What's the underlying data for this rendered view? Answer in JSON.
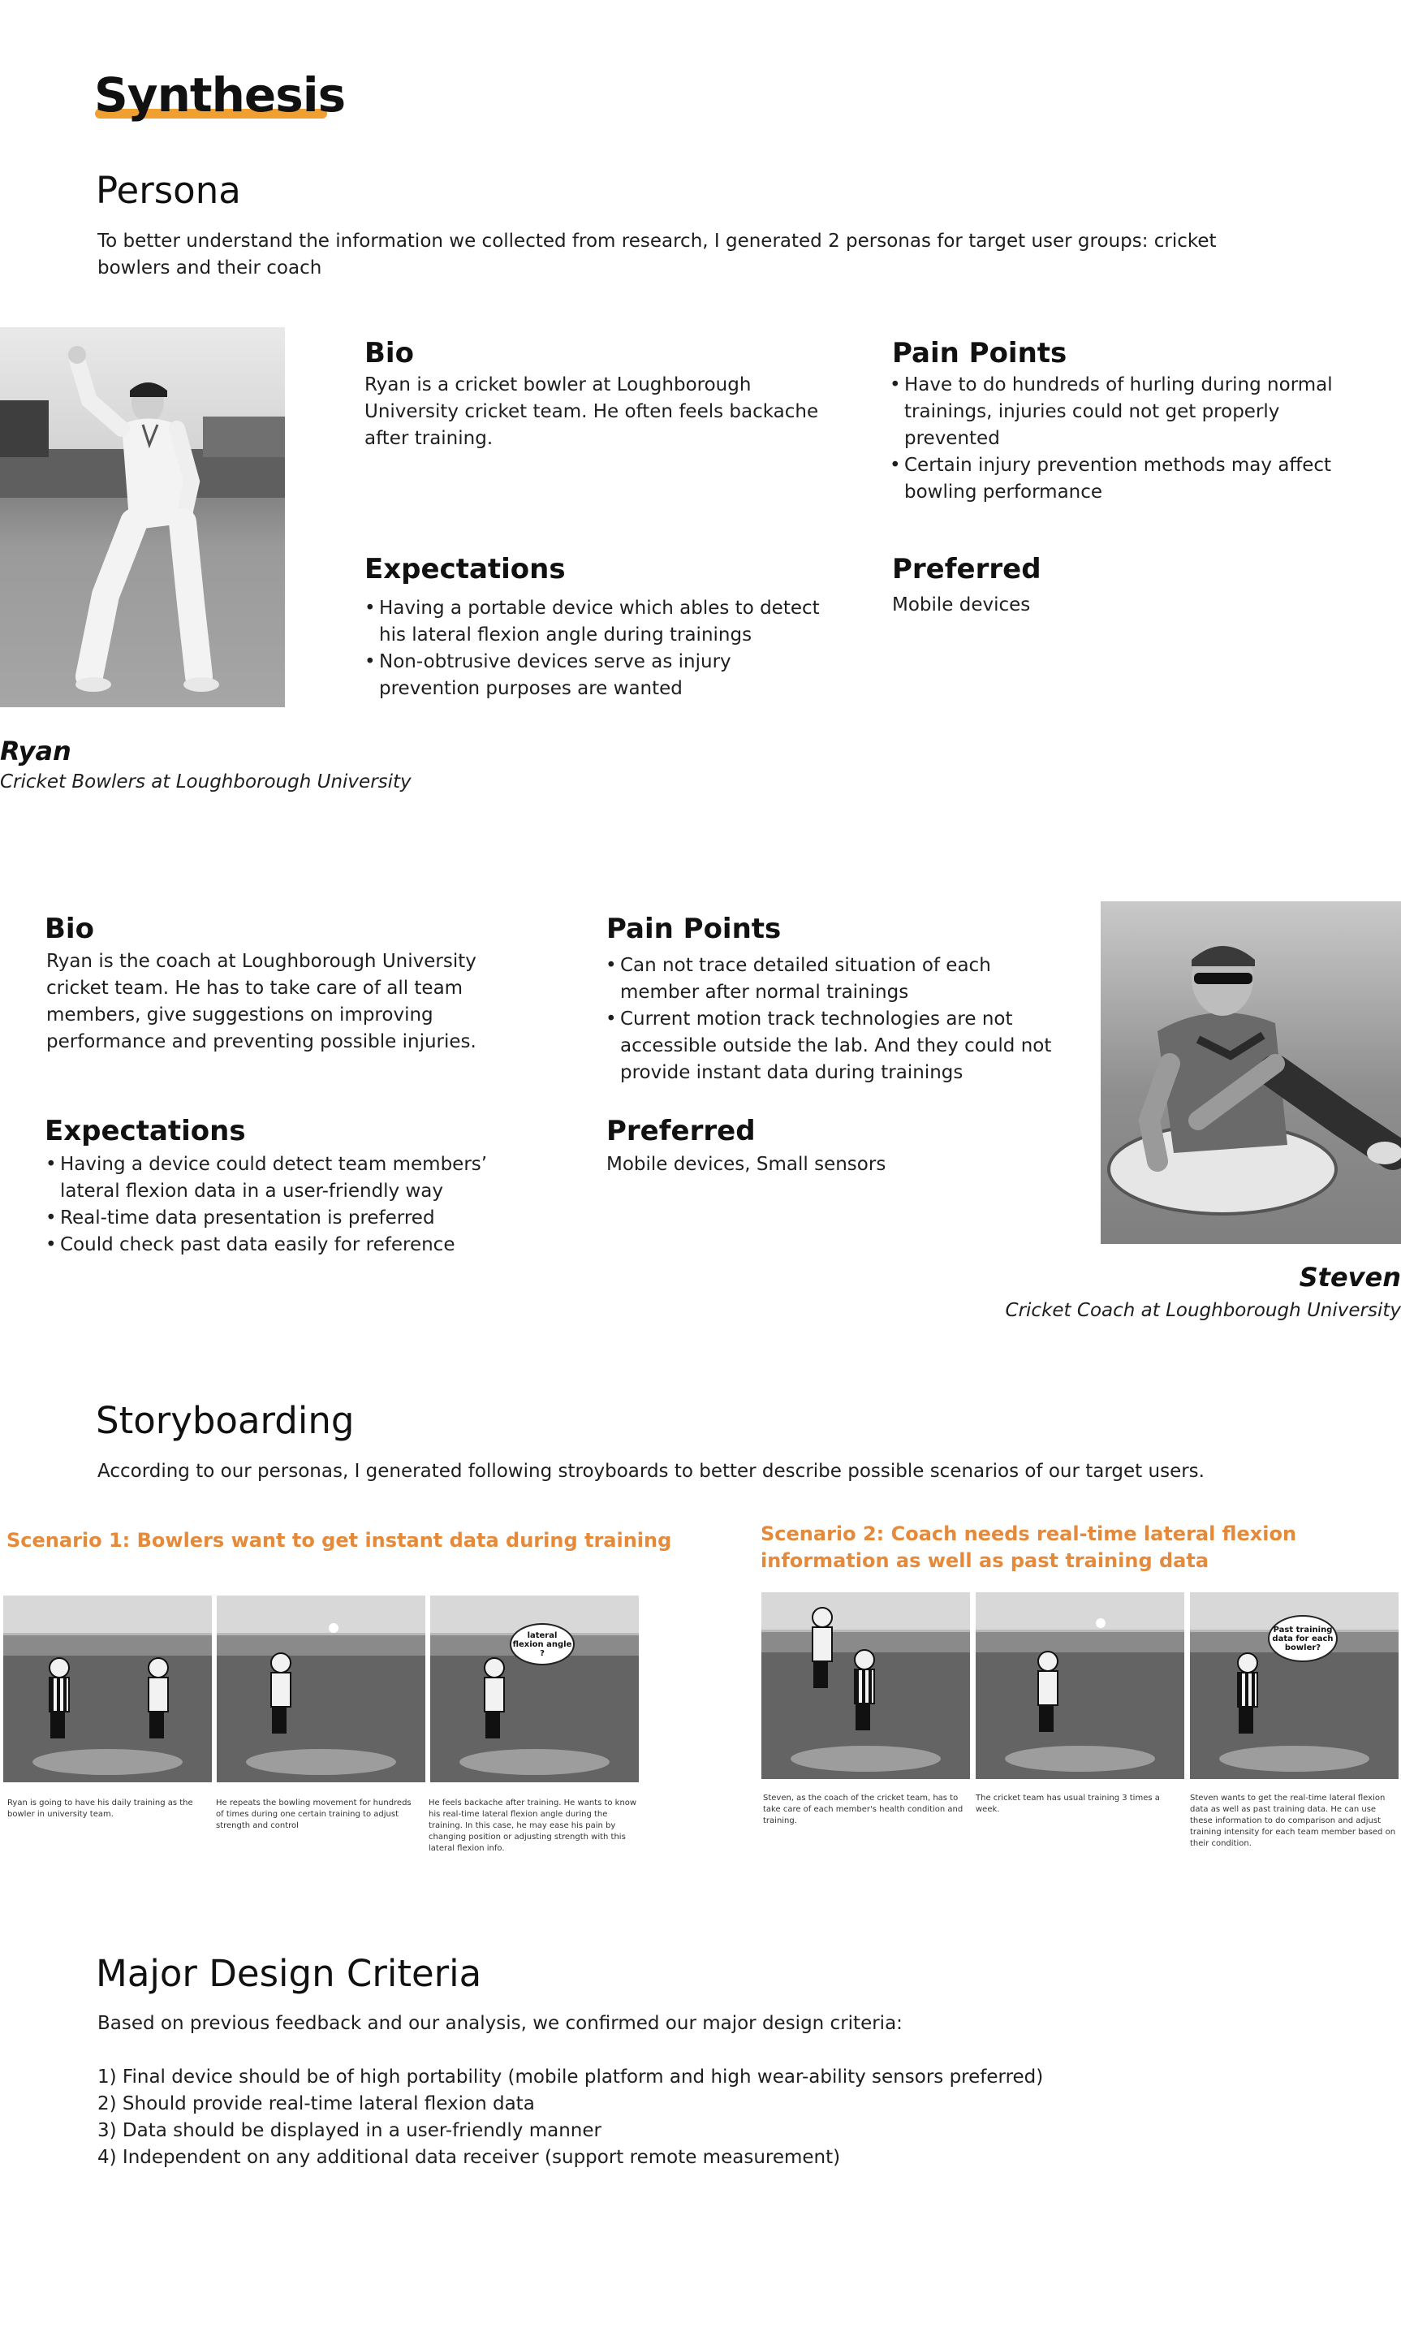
{
  "header": {
    "title": "Synthesis"
  },
  "persona_section": {
    "title": "Persona",
    "intro": "To better understand the information we collected from research, I generated 2 personas for target user groups: cricket bowlers and their coach"
  },
  "persona1": {
    "name": "Ryan",
    "role": "Cricket Bowlers at Loughborough University",
    "bio_title": "Bio",
    "bio": "Ryan is a cricket bowler at Loughborough University cricket team. He often feels backache after training.",
    "pain_title": "Pain Points",
    "pain": [
      "Have to do hundreds of hurling during normal trainings, injuries could not get properly prevented",
      "Certain injury prevention methods may affect bowling performance"
    ],
    "exp_title": "Expectations",
    "exp": [
      "Having a portable device which ables to detect his lateral flexion angle during trainings",
      "Non-obtrusive devices serve as injury prevention purposes are wanted"
    ],
    "pref_title": "Preferred",
    "pref": "Mobile devices"
  },
  "persona2": {
    "name": "Steven",
    "role": "Cricket Coach at Loughborough University",
    "bio_title": "Bio",
    "bio": "Ryan is the coach at Loughborough University cricket team. He has to take care of all team members, give suggestions on improving performance and preventing possible injuries.",
    "pain_title": "Pain Points",
    "pain": [
      "Can not trace detailed situation of each member after normal trainings",
      "Current motion track technologies are not accessible outside the lab. And they could not provide instant data during trainings"
    ],
    "exp_title": "Expectations",
    "exp": [
      "Having a device could detect team members’ lateral flexion data in a user-friendly way",
      "Real-time data presentation is preferred",
      "Could check past data easily for reference"
    ],
    "pref_title": "Preferred",
    "pref": "Mobile devices, Small sensors"
  },
  "storyboard": {
    "title": "Storyboarding",
    "intro": "According to our personas, I generated following stroyboards to better describe possible scenarios of our target users.",
    "scenario1": {
      "title": "Scenario 1: Bowlers want to get instant data during training",
      "captions": [
        "Ryan is going to have his daily training as the bowler in university team.",
        "He repeats the bowling movement for hundreds of times during one certain training to adjust strength and control",
        "He feels backache after training. He wants to know his real-time lateral flexion angle during the training. In this case, he may ease his pain by changing position or adjusting strength with this lateral flexion info."
      ],
      "bubble": "lateral flexion angle ?"
    },
    "scenario2": {
      "title": "Scenario 2: Coach needs real-time lateral flexion information as well as past training data",
      "captions": [
        "Steven, as the coach of the cricket team, has to take care of each member's health condition and training.",
        "The cricket team has usual training 3 times a week.",
        "Steven wants to get the real-time lateral flexion data as well as past training data. He can use these information to do comparison and adjust training intensity for each team member based on their condition."
      ],
      "bubble": "Past training data for each bowler?"
    }
  },
  "criteria": {
    "title": "Major Design Criteria",
    "intro": "Based on previous feedback and our analysis, we confirmed our major design criteria:",
    "items": [
      "1) Final device should be of high portability (mobile platform and high wear-ability sensors preferred)",
      "2) Should provide real-time lateral flexion data",
      "3) Data should be displayed in a user-friendly manner",
      "4) Independent on any additional data receiver (support remote measurement)"
    ]
  }
}
